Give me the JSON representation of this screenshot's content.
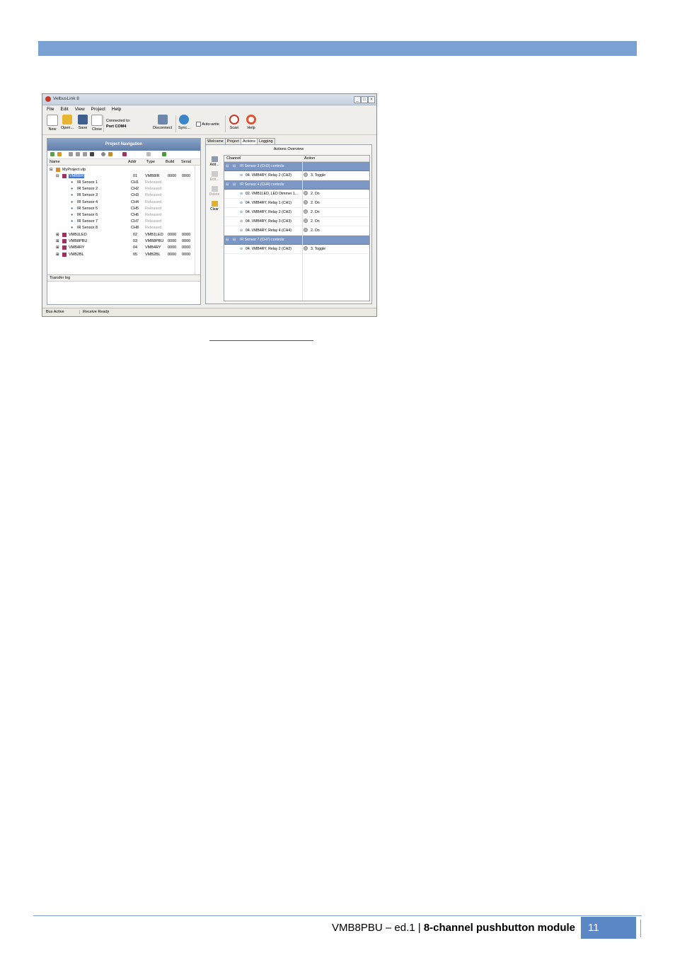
{
  "footer": {
    "doc": "VMB8PBU – ed.1",
    "separator": "|",
    "title": "8-channel pushbutton module",
    "page": "11"
  },
  "screenshot": {
    "title": "VelbusLink 8",
    "menu": [
      "File",
      "Edit",
      "View",
      "Project",
      "Help"
    ],
    "toolbar": {
      "new": "New",
      "open": "Open...",
      "save": "Save",
      "close": "Close",
      "connected_to": "Connected to:",
      "port": "Port COM4",
      "disconnect": "Disconnect",
      "sync": "Sync...",
      "auto_write": "Auto-write",
      "scan": "Scan",
      "help": "Help"
    },
    "nav": {
      "header": "Project Navigation",
      "columns": [
        "Name",
        "Addr",
        "Type",
        "Build",
        "Serial"
      ],
      "project": "MyProject.vlp",
      "module": {
        "name": "VMB8IR",
        "addr": "01",
        "type": "VMB8IR",
        "build": "0000",
        "serial": "0000"
      },
      "channels": [
        {
          "name": "IR Sensor 1",
          "ch": "CH1",
          "state": "Released"
        },
        {
          "name": "IR Sensor 2",
          "ch": "CH2",
          "state": "Released"
        },
        {
          "name": "IR Sensor 3",
          "ch": "CH3",
          "state": "Released"
        },
        {
          "name": "IR Sensor 4",
          "ch": "CH4",
          "state": "Released"
        },
        {
          "name": "IR Sensor 5",
          "ch": "CH5",
          "state": "Released"
        },
        {
          "name": "IR Sensor 6",
          "ch": "CH6",
          "state": "Released"
        },
        {
          "name": "IR Sensor 7",
          "ch": "CH7",
          "state": "Released"
        },
        {
          "name": "IR Sensor 8",
          "ch": "CH8",
          "state": "Released"
        }
      ],
      "other_modules": [
        {
          "name": "VMB1LED",
          "addr": "02",
          "type": "VMB1LED",
          "build": "0000",
          "serial": "0000"
        },
        {
          "name": "VMB8PBU",
          "addr": "03",
          "type": "VMB8PBU",
          "build": "0000",
          "serial": "0000"
        },
        {
          "name": "VMB4RY",
          "addr": "04",
          "type": "VMB4RY",
          "build": "0000",
          "serial": "0000"
        },
        {
          "name": "VMB2BL",
          "addr": "05",
          "type": "VMB2BL",
          "build": "0000",
          "serial": "0000"
        }
      ],
      "transfer_log": "Transfer log"
    },
    "tabs": [
      "Welcome",
      "Project",
      "Actions",
      "Logging"
    ],
    "actions": {
      "title": "Actions Overview",
      "side": {
        "add": "Add...",
        "edit": "Edit...",
        "delete": "Delete",
        "clear": "Clear"
      },
      "columns": [
        "Channel",
        "Action"
      ],
      "rows": [
        {
          "kind": "group",
          "channel": "IR Sensor 3 (CH3) controls:"
        },
        {
          "kind": "item",
          "channel": "04. VMB4RY, Relay 2 (CH2)",
          "action": "3. Toggle"
        },
        {
          "kind": "group",
          "channel": "IR Sensor 4 (CH4) controls:"
        },
        {
          "kind": "item",
          "channel": "02. VMB1LED, LED Dimmer 1...",
          "action": "2. On"
        },
        {
          "kind": "item",
          "channel": "04. VMB4RY, Relay 1 (CH1)",
          "action": "2. On"
        },
        {
          "kind": "item",
          "channel": "04. VMB4RY, Relay 2 (CH2)",
          "action": "2. On"
        },
        {
          "kind": "item",
          "channel": "04. VMB4RY, Relay 3 (CH3)",
          "action": "2. On"
        },
        {
          "kind": "item",
          "channel": "04. VMB4RY, Relay 4 (CH4)",
          "action": "2. On"
        },
        {
          "kind": "group",
          "channel": "IR Sensor 7 (CH7) controls:"
        },
        {
          "kind": "item",
          "channel": "04. VMB4RY, Relay 2 (CH2)",
          "action": "3. Toggle"
        }
      ]
    },
    "status": {
      "bus": "Bus Active",
      "receive": "Receive Ready"
    }
  }
}
